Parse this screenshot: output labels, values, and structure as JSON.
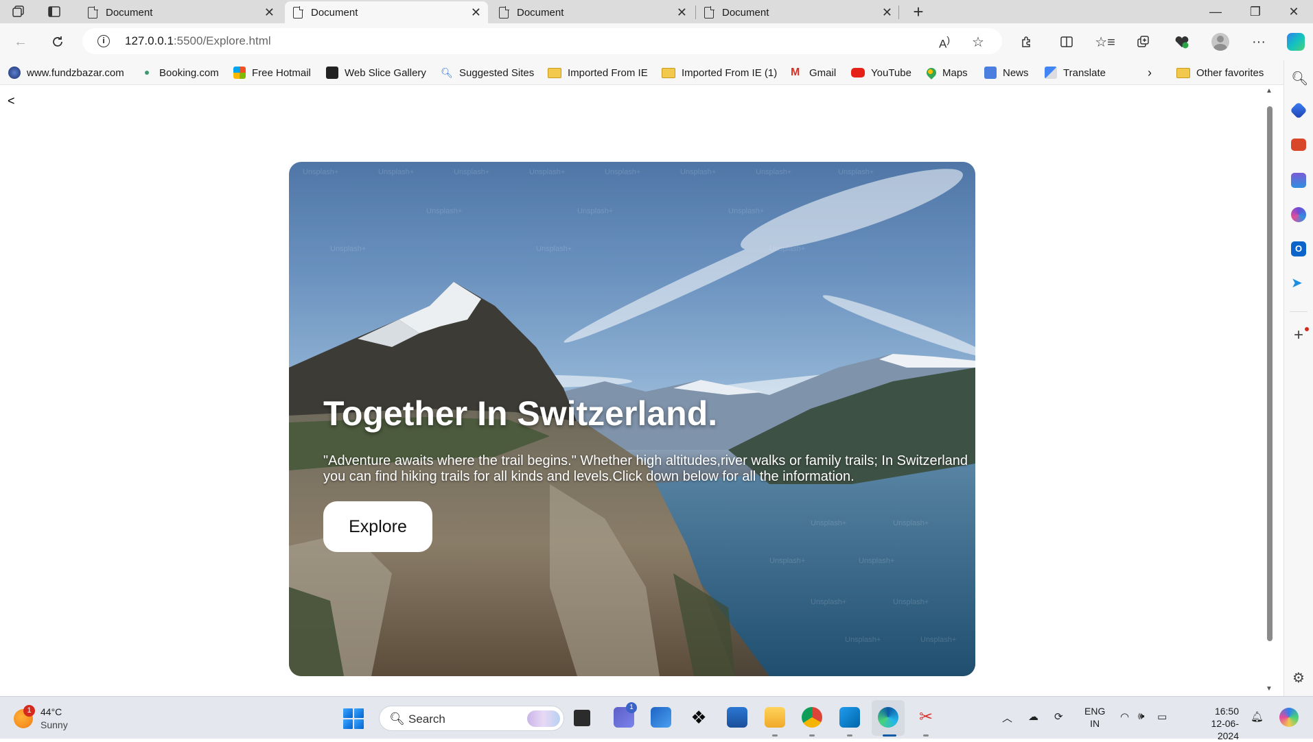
{
  "browser": {
    "tabs": [
      {
        "title": "Document",
        "active": false
      },
      {
        "title": "Document",
        "active": true
      },
      {
        "title": "Document",
        "active": false
      },
      {
        "title": "Document",
        "active": false
      }
    ],
    "url_host": "127.0.0.1",
    "url_path": ":5500/Explore.html",
    "favorites": [
      {
        "label": "www.fundzbazar.com",
        "icon": "globe-icon"
      },
      {
        "label": "Booking.com",
        "icon": "booking-icon"
      },
      {
        "label": "Free Hotmail",
        "icon": "microsoft-icon"
      },
      {
        "label": "Web Slice Gallery",
        "icon": "web-slice-icon"
      },
      {
        "label": "Suggested Sites",
        "icon": "search-icon"
      },
      {
        "label": "Imported From IE",
        "icon": "folder-icon"
      },
      {
        "label": "Imported From IE (1)",
        "icon": "folder-icon"
      },
      {
        "label": "Gmail",
        "icon": "gmail-icon"
      },
      {
        "label": "YouTube",
        "icon": "youtube-icon"
      },
      {
        "label": "Maps",
        "icon": "maps-icon"
      },
      {
        "label": "News",
        "icon": "news-icon"
      },
      {
        "label": "Translate",
        "icon": "translate-icon"
      }
    ],
    "other_favorites": "Other favorites"
  },
  "page": {
    "back_link": "<",
    "hero": {
      "title": "Together In Switzerland.",
      "description": "\"Adventure awaits where the trail begins.\" Whether high altitudes,river walks or family trails; In Switzerland you can find hiking trails for all kinds and levels.Click down below for all the information.",
      "button_label": "Explore",
      "watermark": "Unsplash+"
    }
  },
  "taskbar": {
    "weather_temp": "44°C",
    "weather_desc": "Sunny",
    "weather_badge": "1",
    "search_label": "Search",
    "teams_badge": "1",
    "lang_line1": "ENG",
    "lang_line2": "IN",
    "time": "16:50",
    "date": "12-06-2024"
  },
  "colors": {
    "tabstrip_bg": "#dcdcdc",
    "toolbar_bg": "#f7f7f7",
    "taskbar_bg": "#e4e7ee",
    "hero_button_bg": "#ffffff"
  }
}
